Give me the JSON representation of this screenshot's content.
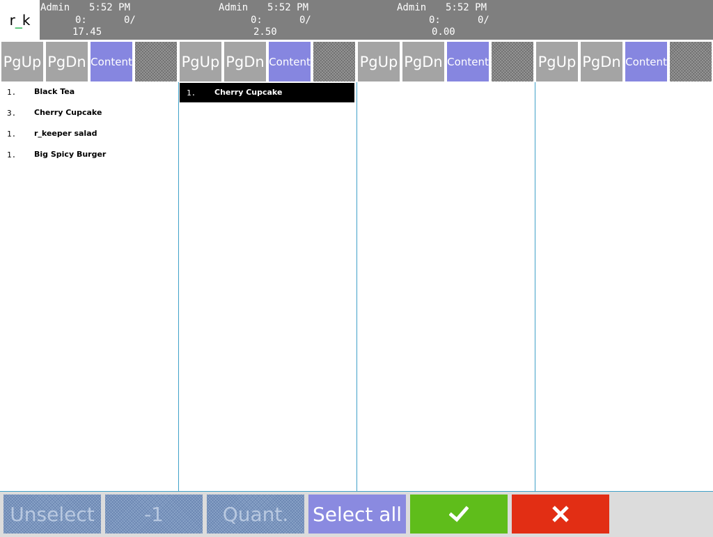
{
  "header": {
    "logo": {
      "left": "r",
      "sep": "_",
      "right": "k"
    },
    "checks": [
      {
        "user": "Admin",
        "time": "5:52 PM",
        "guests": "0:",
        "table": "0/",
        "total": "17.45"
      },
      {
        "user": "Admin",
        "time": "5:52 PM",
        "guests": "0:",
        "table": "0/",
        "total": "2.50"
      },
      {
        "user": "Admin",
        "time": "5:52 PM",
        "guests": "0:",
        "table": "0/",
        "total": "0.00"
      }
    ]
  },
  "columns": [
    {
      "toolbar": {
        "pgup": "PgUp",
        "pgdn": "PgDn",
        "content": "Content"
      },
      "items": [
        {
          "qty": "1.",
          "name": "Black Tea"
        },
        {
          "qty": "3.",
          "name": "Cherry Cupcake"
        },
        {
          "qty": "1.",
          "name": "r_keeper salad"
        },
        {
          "qty": "1.",
          "name": "Big Spicy Burger"
        }
      ]
    },
    {
      "toolbar": {
        "pgup": "PgUp",
        "pgdn": "PgDn",
        "content": "Content"
      },
      "items": [
        {
          "qty": "1.",
          "name": "Cherry Cupcake",
          "selected": true
        }
      ]
    },
    {
      "toolbar": {
        "pgup": "PgUp",
        "pgdn": "PgDn",
        "content": "Content"
      },
      "items": []
    },
    {
      "toolbar": {
        "pgup": "PgUp",
        "pgdn": "PgDn",
        "content": "Content"
      },
      "items": []
    }
  ],
  "bottombar": {
    "unselect": "Unselect",
    "minus_one": "-1",
    "quant": "Quant.",
    "select_all": "Select all",
    "ok_icon": "checkmark-icon",
    "cancel_icon": "close-icon"
  },
  "colors": {
    "header_bg": "#7f7f7f",
    "pg_button": "#a4a4a4",
    "content_button": "#8686e0",
    "ok_button": "#5fbd1b",
    "cancel_button": "#e22e14",
    "select_all_button": "#8a8ae0",
    "selected_row": "#000000"
  }
}
